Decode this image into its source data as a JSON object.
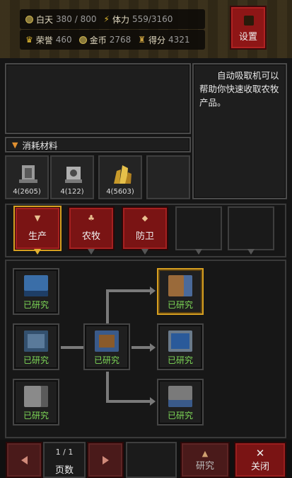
{
  "topbar": {
    "day_label": "白天",
    "day_value": "380 / 800",
    "stamina_label": "体力",
    "stamina_value": "559/3160",
    "honor_label": "荣誉",
    "honor_value": "460",
    "gold_label": "金币",
    "gold_value": "2768",
    "score_label": "得分",
    "score_value": "4321",
    "settings_label": "设置"
  },
  "info": {
    "description": "自动吸取机可以帮助你快速收取农牧产品。"
  },
  "materials": {
    "header": "消耗材料",
    "items": [
      {
        "icon": "statue-material-icon",
        "count": "4(2605)"
      },
      {
        "icon": "ore-material-icon",
        "count": "4(122)"
      },
      {
        "icon": "gold-crystal-icon",
        "count": "4(5603)"
      }
    ]
  },
  "tabs": [
    {
      "label": "生产",
      "selected": true
    },
    {
      "label": "农牧",
      "selected": false
    },
    {
      "label": "防卫",
      "selected": false
    }
  ],
  "tree": {
    "researched_label": "已研究",
    "colors": {
      "researched": "#7ed957",
      "highlight": "#d8a020"
    }
  },
  "bottom": {
    "page": "1 / 1",
    "page_label": "页数",
    "research_label": "研究",
    "close_label": "关闭"
  }
}
